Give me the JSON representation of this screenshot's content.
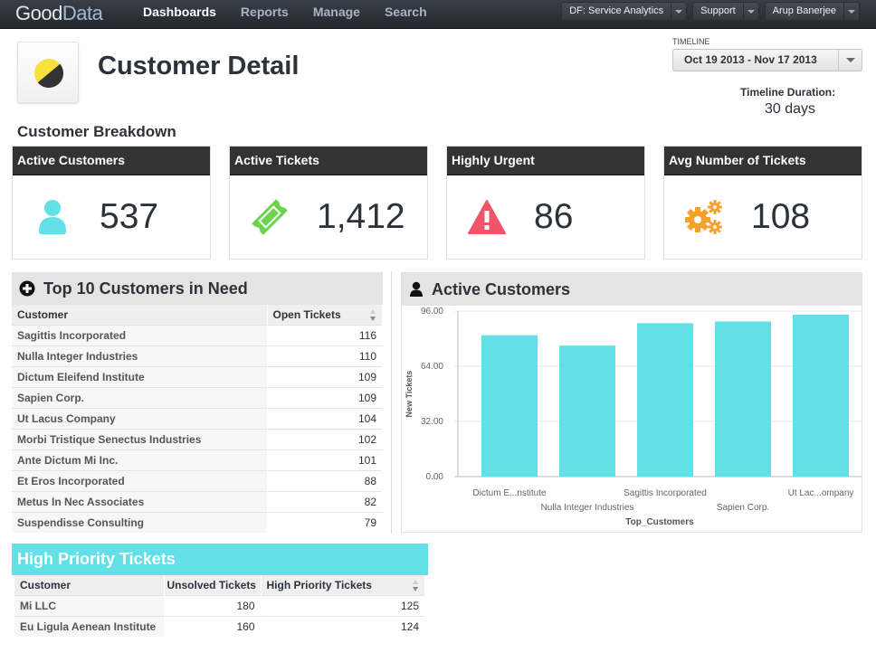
{
  "app": {
    "logo_part1": "Good",
    "logo_part2": "Data",
    "nav": [
      {
        "label": "Dashboards",
        "active": true
      },
      {
        "label": "Reports",
        "active": false
      },
      {
        "label": "Manage",
        "active": false
      },
      {
        "label": "Search",
        "active": false
      }
    ],
    "project_button": "DF: Service Analytics",
    "support_button": "Support",
    "user_button": "Arup Banerjee"
  },
  "header": {
    "title": "Customer Detail",
    "section_title": "Customer Breakdown",
    "timeline_label": "TIMELINE",
    "timeline_value": "Oct 19 2013 - Nov 17 2013",
    "duration_label": "Timeline Duration:",
    "duration_value": "30 days"
  },
  "kpis": [
    {
      "title": "Active Customers",
      "value": "537",
      "icon": "user-icon",
      "color": "#62e0e8"
    },
    {
      "title": "Active Tickets",
      "value": "1,412",
      "icon": "ticket-icon",
      "color": "#6cd44a"
    },
    {
      "title": "Highly Urgent",
      "value": "86",
      "icon": "warning-icon",
      "color": "#ef5468"
    },
    {
      "title": "Avg Number of Tickets",
      "value": "108",
      "icon": "gears-icon",
      "color": "#f5a12e"
    }
  ],
  "top10": {
    "title": "Top 10 Customers in Need",
    "columns": [
      "Customer",
      "Open Tickets"
    ],
    "rows": [
      [
        "Sagittis Incorporated",
        "116"
      ],
      [
        "Nulla Integer Industries",
        "110"
      ],
      [
        "Dictum Eleifend Institute",
        "109"
      ],
      [
        "Sapien Corp.",
        "109"
      ],
      [
        "Ut Lacus Company",
        "104"
      ],
      [
        "Morbi Tristique Senectus Industries",
        "102"
      ],
      [
        "Ante Dictum Mi Inc.",
        "101"
      ],
      [
        "Et Eros Incorporated",
        "88"
      ],
      [
        "Metus In Nec Associates",
        "82"
      ],
      [
        "Suspendisse Consulting",
        "79"
      ]
    ]
  },
  "chart_panel_title": "Active Customers",
  "chart_data": {
    "type": "bar",
    "title": "Active Customers",
    "categories": [
      "Dictum E...nstitute",
      "Nulla Integer Industries",
      "Sagittis Incorporated",
      "Sapien Corp.",
      "Ut Lac...ompany"
    ],
    "values": [
      82,
      76,
      89,
      90,
      94
    ],
    "xlabel": "Top_Customers",
    "ylabel": "New Tickets",
    "ylim": [
      0,
      96
    ],
    "yticks": [
      "0.00",
      "32.00",
      "64.00",
      "96.00"
    ],
    "ytick_values": [
      0,
      32,
      64,
      96
    ],
    "grid": true,
    "color": "#62e0e8"
  },
  "high_priority": {
    "title": "High Priority Tickets",
    "columns": [
      "Customer",
      "Unsolved Tickets",
      "High Priority Tickets"
    ],
    "rows": [
      [
        "Mi LLC",
        "180",
        "125"
      ],
      [
        "Eu Ligula Aenean Institute",
        "160",
        "124"
      ]
    ]
  }
}
